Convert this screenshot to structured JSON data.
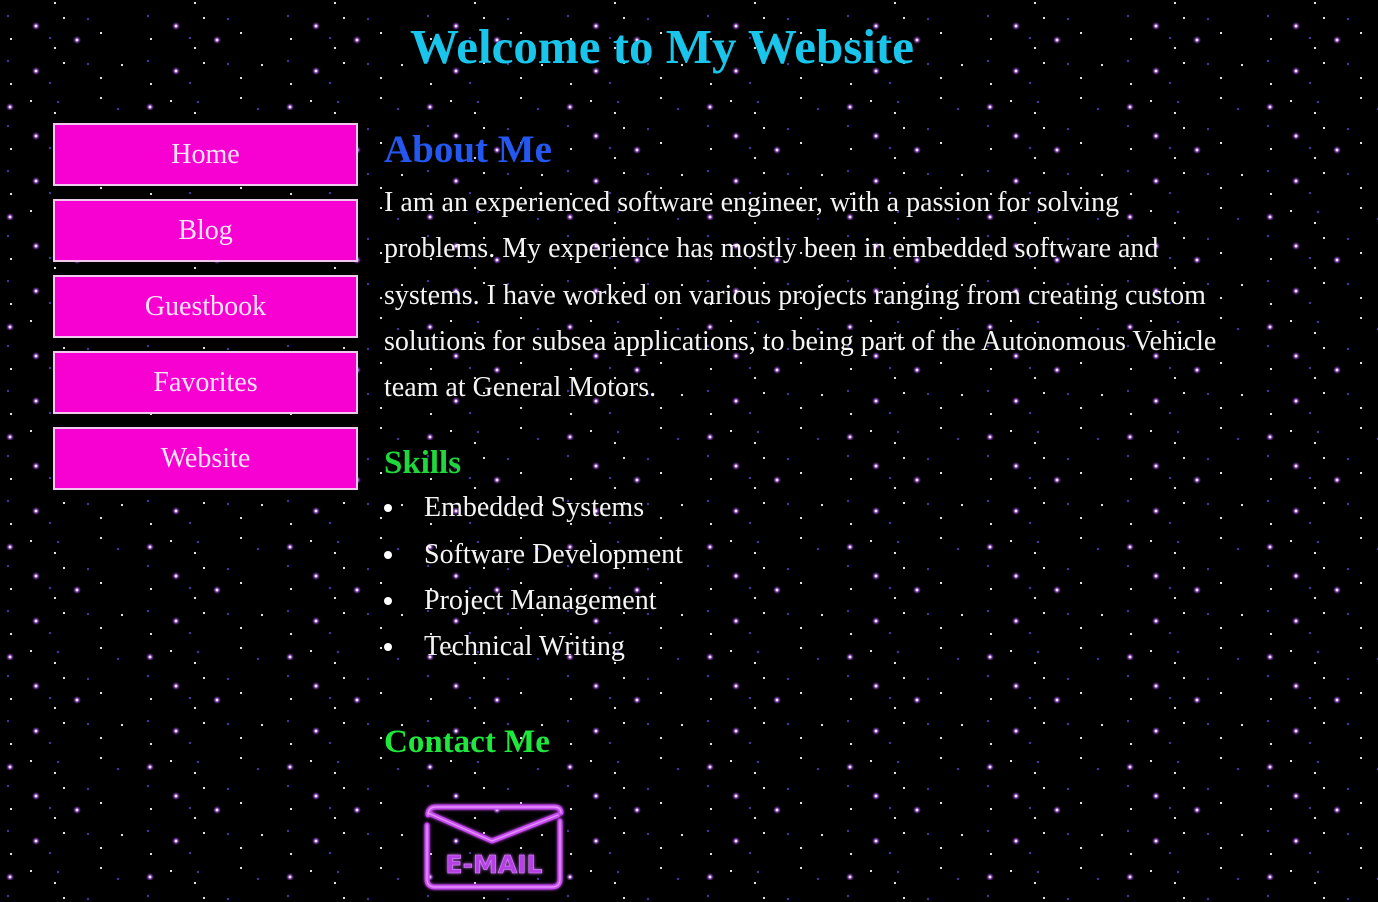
{
  "header": {
    "title": "Welcome to My Website"
  },
  "nav": {
    "items": [
      {
        "label": "Home"
      },
      {
        "label": "Blog"
      },
      {
        "label": "Guestbook"
      },
      {
        "label": "Favorites"
      },
      {
        "label": "Website"
      }
    ]
  },
  "about": {
    "heading": "About Me",
    "text": "I am an experienced software engineer, with a passion for solving problems. My experience has mostly been in embedded software and systems. I have worked on various projects ranging from creating custom solutions for subsea applications, to being part of the Autonomous Vehicle team at General Motors."
  },
  "skills": {
    "heading": "Skills",
    "items": [
      "Embedded Systems",
      "Software Development",
      "Project Management",
      "Technical Writing"
    ]
  },
  "contact": {
    "heading": "Contact Me",
    "email_icon_text": "E-MAIL",
    "email_icon": "envelope-neon-icon"
  },
  "colors": {
    "background": "#000000",
    "title": "#19c5ea",
    "about_heading": "#2457f0",
    "skills_heading": "#1fd83c",
    "nav_button": "#f700d2",
    "nav_border": "#f0c8ee",
    "email_neon": "#c23cf0"
  }
}
